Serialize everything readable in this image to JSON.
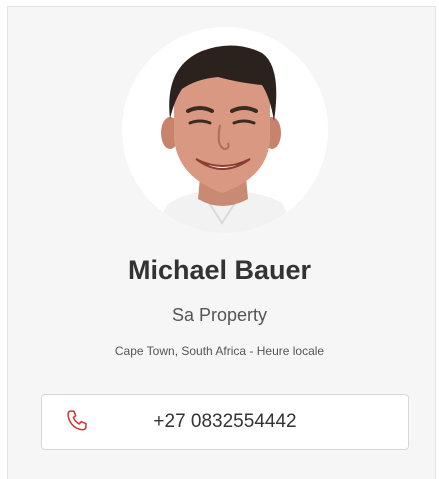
{
  "profile": {
    "name": "Michael Bauer",
    "company": "Sa Property",
    "location": "Cape Town, South Africa - Heure locale",
    "phone": "+27 0832554442",
    "avatar_icon": "user-photo",
    "phone_icon": "phone-icon",
    "accent_color": "#d0342c"
  }
}
